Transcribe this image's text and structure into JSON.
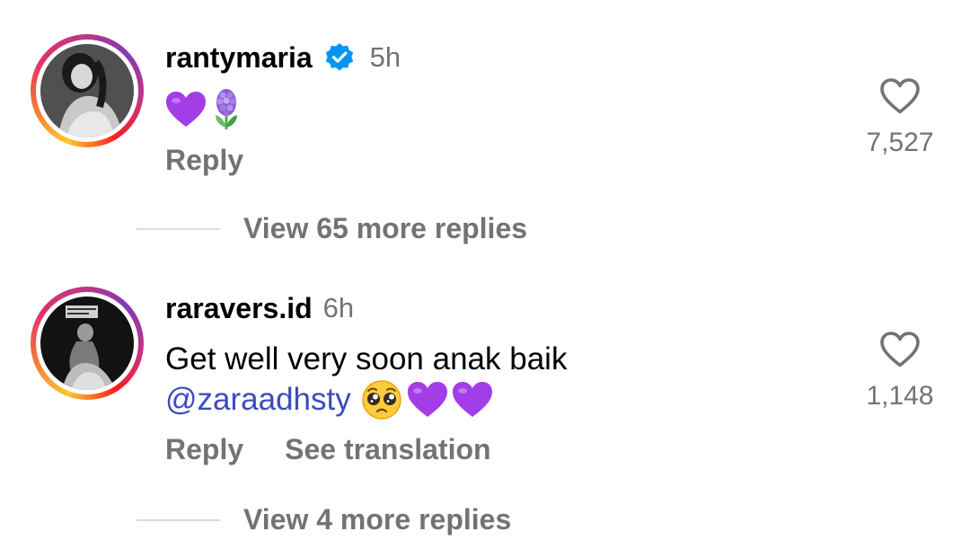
{
  "comments": [
    {
      "username": "rantymaria",
      "verified": true,
      "time": "5h",
      "emojis": [
        "purple-heart",
        "hyacinth"
      ],
      "actions": {
        "reply": "Reply"
      },
      "likes": "7,527",
      "view_replies": "View 65 more replies"
    },
    {
      "username": "raravers.id",
      "verified": false,
      "time": "6h",
      "text_line_1": "Get well very soon anak baik",
      "mention": "@zaraadhsty",
      "emojis": [
        "pleading-face",
        "purple-heart",
        "purple-heart"
      ],
      "actions": {
        "reply": "Reply",
        "translate": "See translation"
      },
      "likes": "1,148",
      "view_replies": "View 4 more replies"
    }
  ],
  "colors": {
    "secondary_text": "#737373",
    "mention": "#3e4bbd",
    "verified_badge": "#0095f6",
    "purple_heart": "#a23de8",
    "divider": "#dbdbdb"
  },
  "icons": {
    "verified": "verified-badge-icon",
    "like": "heart-outline-icon"
  }
}
